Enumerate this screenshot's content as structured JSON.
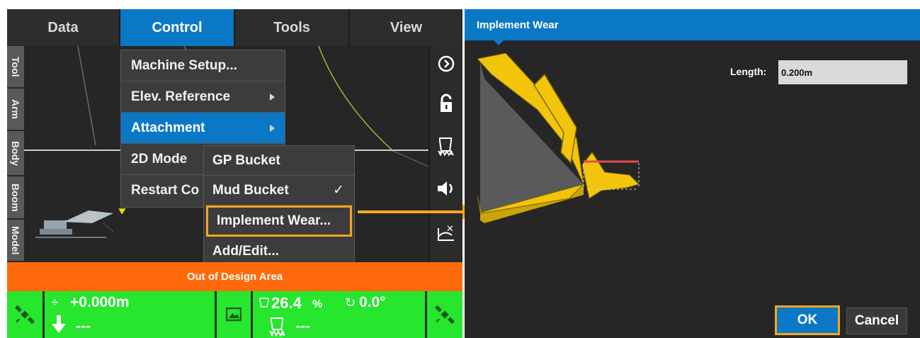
{
  "left_screen": {
    "menu": {
      "tabs": [
        {
          "label": "Data",
          "active": false
        },
        {
          "label": "Control",
          "active": true
        },
        {
          "label": "Tools",
          "active": false
        },
        {
          "label": "View",
          "active": false
        }
      ]
    },
    "control_dropdown": {
      "items": [
        {
          "label": "Machine Setup...",
          "has_submenu": false
        },
        {
          "label": "Elev. Reference",
          "has_submenu": true
        },
        {
          "label": "Attachment",
          "has_submenu": true,
          "active": true
        },
        {
          "label": "2D Mode",
          "has_submenu": false
        },
        {
          "label": "Restart Co",
          "has_submenu": false
        }
      ]
    },
    "attachment_submenu": {
      "items": [
        {
          "label": "GP Bucket",
          "checked": false
        },
        {
          "label": "Mud Bucket",
          "checked": true,
          "check_mark": "✓"
        },
        {
          "label": "Implement Wear...",
          "highlighted": true
        },
        {
          "label": "Add/Edit..."
        }
      ]
    },
    "side_tabs": [
      "Tool",
      "Arm",
      "Body",
      "Boom",
      "Model"
    ],
    "right_icons": [
      "chevron-circle-icon",
      "padlock-icon",
      "bucket-icon",
      "speaker-icon",
      "wear-icon"
    ],
    "alert": "Out of Design Area",
    "status": {
      "elevation": "+0.000m",
      "cut_fill": "---",
      "percent_value": "26.4",
      "percent_unit": "%",
      "angle": "0.0°",
      "bucket_value": "---"
    }
  },
  "right_screen": {
    "title": "Implement Wear",
    "length_label": "Length:",
    "length_value": "0.200m",
    "ok_label": "OK",
    "cancel_label": "Cancel"
  },
  "colors": {
    "accent_blue": "#0b78c6",
    "highlight_orange": "#f5a623",
    "alert_orange": "#ff6a0c",
    "status_green": "#26e62e",
    "bucket_yellow": "#f2c40c"
  }
}
